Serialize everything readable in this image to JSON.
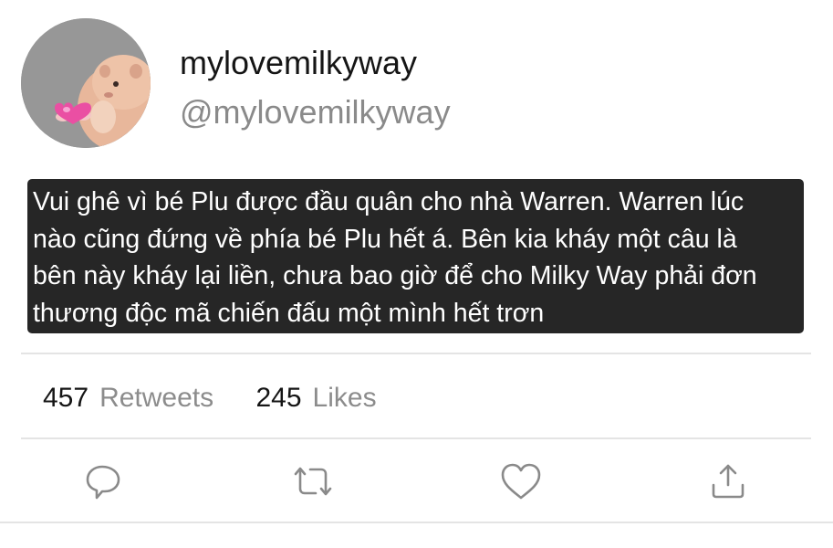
{
  "user": {
    "display_name": "mylovemilkyway",
    "handle": "@mylovemilkyway",
    "avatar_icon": "hamster-holding-heart-avatar"
  },
  "tweet": {
    "text": "Vui ghê vì bé Plu được đầu quân cho nhà Warren. Warren lúc\nnào cũng đứng về phía bé Plu hết á. Bên kia kháy một câu là\nbên này kháy lại liền, chưa bao giờ để cho Milky Way phải đơn\nthương độc mã chiến đấu một mình hết trơn"
  },
  "stats": {
    "retweets_count": "457",
    "retweets_label": "Retweets",
    "likes_count": "245",
    "likes_label": "Likes"
  },
  "actions": [
    {
      "icon": "reply-icon"
    },
    {
      "icon": "retweet-icon"
    },
    {
      "icon": "like-icon"
    },
    {
      "icon": "share-icon"
    }
  ],
  "colors": {
    "tweet_background": "#262626",
    "tweet_text": "#ffffff",
    "secondary_text": "#8a8a8a",
    "icon": "#8a8a8a",
    "divider": "#e4e4e4"
  }
}
